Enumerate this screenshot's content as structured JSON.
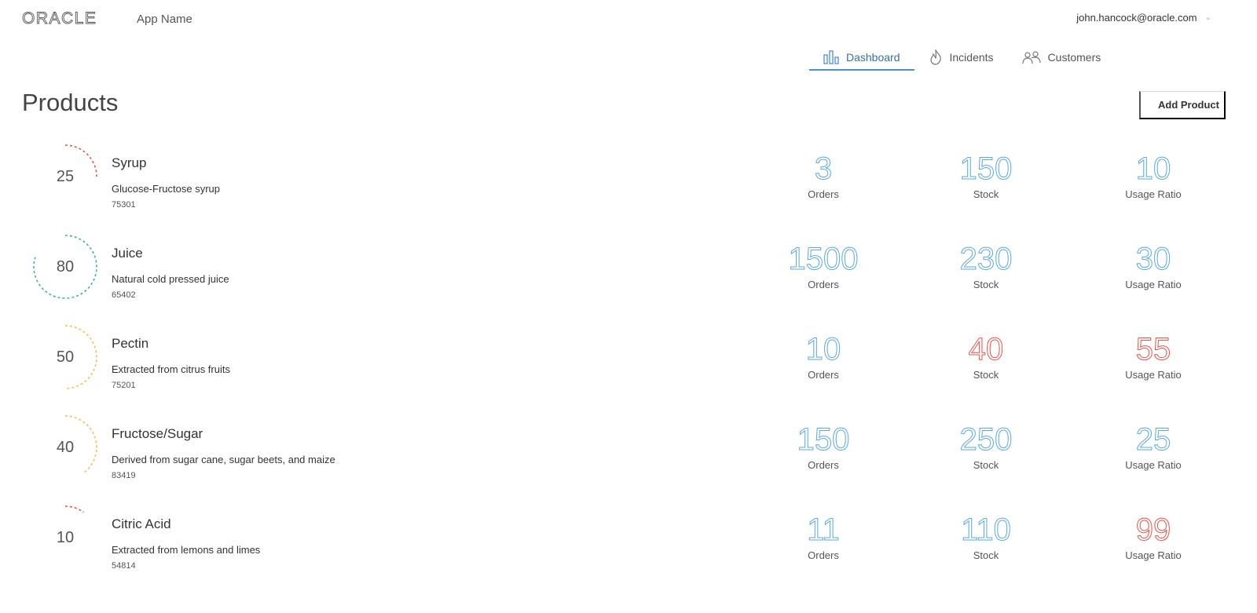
{
  "header": {
    "logo_text": "ORACLE",
    "app_name": "App Name",
    "user_email": "john.hancock@oracle.com"
  },
  "nav": {
    "items": [
      {
        "label": "Dashboard",
        "icon": "bar-chart-icon",
        "active": true
      },
      {
        "label": "Incidents",
        "icon": "flame-icon",
        "active": false
      },
      {
        "label": "Customers",
        "icon": "people-icon",
        "active": false
      }
    ]
  },
  "page": {
    "title": "Products",
    "add_button_label": "Add Product"
  },
  "colors": {
    "accent": "#4a90d9",
    "metric_blue": "#5aa9e6",
    "metric_red": "#e8534a",
    "gauge_red": "#e8534a",
    "gauge_green": "#3bb98c",
    "gauge_yellow": "#f2c14e"
  },
  "metric_labels": {
    "orders": "Orders",
    "stock": "Stock",
    "usage": "Usage Ratio"
  },
  "products": [
    {
      "name": "Syrup",
      "description": "Glucose-Fructose syrup",
      "code": "75301",
      "gauge": "25",
      "gauge_color": "red",
      "orders": "3",
      "orders_color": "blue",
      "stock": "150",
      "stock_color": "blue",
      "usage": "10",
      "usage_color": "blue"
    },
    {
      "name": "Juice",
      "description": "Natural cold pressed juice",
      "code": "65402",
      "gauge": "80",
      "gauge_color": "green",
      "orders": "1500",
      "orders_color": "blue",
      "stock": "230",
      "stock_color": "blue",
      "usage": "30",
      "usage_color": "blue"
    },
    {
      "name": "Pectin",
      "description": "Extracted from citrus fruits",
      "code": "75201",
      "gauge": "50",
      "gauge_color": "yellow",
      "orders": "10",
      "orders_color": "blue",
      "stock": "40",
      "stock_color": "red",
      "usage": "55",
      "usage_color": "red"
    },
    {
      "name": "Fructose/Sugar",
      "description": "Derived from sugar cane, sugar beets, and maize",
      "code": "83419",
      "gauge": "40",
      "gauge_color": "yellow",
      "orders": "150",
      "orders_color": "blue",
      "stock": "250",
      "stock_color": "blue",
      "usage": "25",
      "usage_color": "blue"
    },
    {
      "name": "Citric Acid",
      "description": "Extracted from lemons and limes",
      "code": "54814",
      "gauge": "10",
      "gauge_color": "red",
      "orders": "11",
      "orders_color": "blue",
      "stock": "110",
      "stock_color": "blue",
      "usage": "99",
      "usage_color": "red"
    }
  ]
}
